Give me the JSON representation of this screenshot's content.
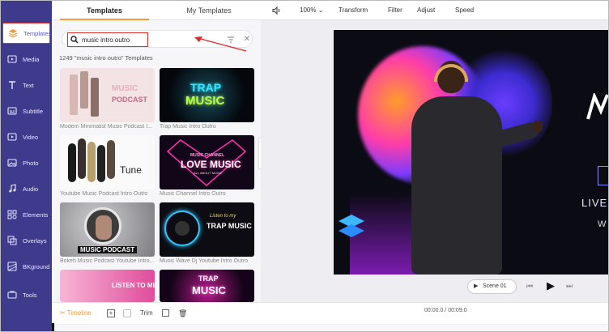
{
  "sidebar": {
    "items": [
      {
        "label": "Templates",
        "icon": "templates-icon",
        "active": true
      },
      {
        "label": "Media",
        "icon": "media-icon"
      },
      {
        "label": "Text",
        "icon": "text-icon"
      },
      {
        "label": "Subtitle",
        "icon": "subtitle-icon"
      },
      {
        "label": "Video",
        "icon": "video-icon"
      },
      {
        "label": "Photo",
        "icon": "photo-icon"
      },
      {
        "label": "Audio",
        "icon": "audio-icon"
      },
      {
        "label": "Elements",
        "icon": "elements-icon"
      },
      {
        "label": "Overlays",
        "icon": "overlays-icon"
      },
      {
        "label": "BKground",
        "icon": "background-icon"
      },
      {
        "label": "Tools",
        "icon": "tools-icon"
      }
    ]
  },
  "panel": {
    "tabs": [
      "Templates",
      "My Templates"
    ],
    "search": {
      "value": "music intro outro"
    },
    "result_count": "1249 \"music intro outro\" Templates",
    "templates": [
      {
        "caption": "Modern Minimalist Music Podcast I...",
        "thumb": {
          "lines": [
            "MUSIC",
            "PODCAST"
          ]
        }
      },
      {
        "caption": "Trap Music Intro Outro",
        "thumb": {
          "lines": [
            "TRAP",
            "MUSIC"
          ]
        }
      },
      {
        "caption": "Youtube Music Podcast Intro Outro",
        "thumb": {
          "lines": [
            "Tune"
          ]
        }
      },
      {
        "caption": "Music Channel Intro Outro",
        "thumb": {
          "lines": [
            "MUSIC CHANNEL",
            "LOVE MUSIC",
            "ALL ABOUT MUSIC"
          ]
        }
      },
      {
        "caption": "Bokeh Music Podcast Youtube Intro...",
        "thumb": {
          "lines": [
            "MUSIC PODCAST"
          ]
        }
      },
      {
        "caption": "Music Wave Dj Youtube Intro Outro",
        "thumb": {
          "lines": [
            "Listen to my",
            "TRAP MUSIC"
          ]
        }
      },
      {
        "caption": "",
        "thumb": {
          "lines": [
            "LISTEN TO ME"
          ]
        }
      },
      {
        "caption": "",
        "thumb": {
          "lines": [
            "TRAP",
            "MUSIC"
          ]
        }
      }
    ]
  },
  "toolbar": {
    "volume_icon": "volume-icon",
    "zoom": "100%",
    "items": [
      "Transform",
      "Filter",
      "Adjust",
      "Speed"
    ]
  },
  "preview": {
    "text_lines": [
      "LIVE M",
      "W"
    ]
  },
  "player": {
    "scene_label": "Scene 01"
  },
  "timeline": {
    "label": "Timeline",
    "trim": "Trim",
    "time": "00:00.0 / 00:09.0"
  },
  "colors": {
    "sidebar_bg": "#3e3a8c",
    "accent": "#f29b38",
    "highlight": "#e0302b"
  }
}
